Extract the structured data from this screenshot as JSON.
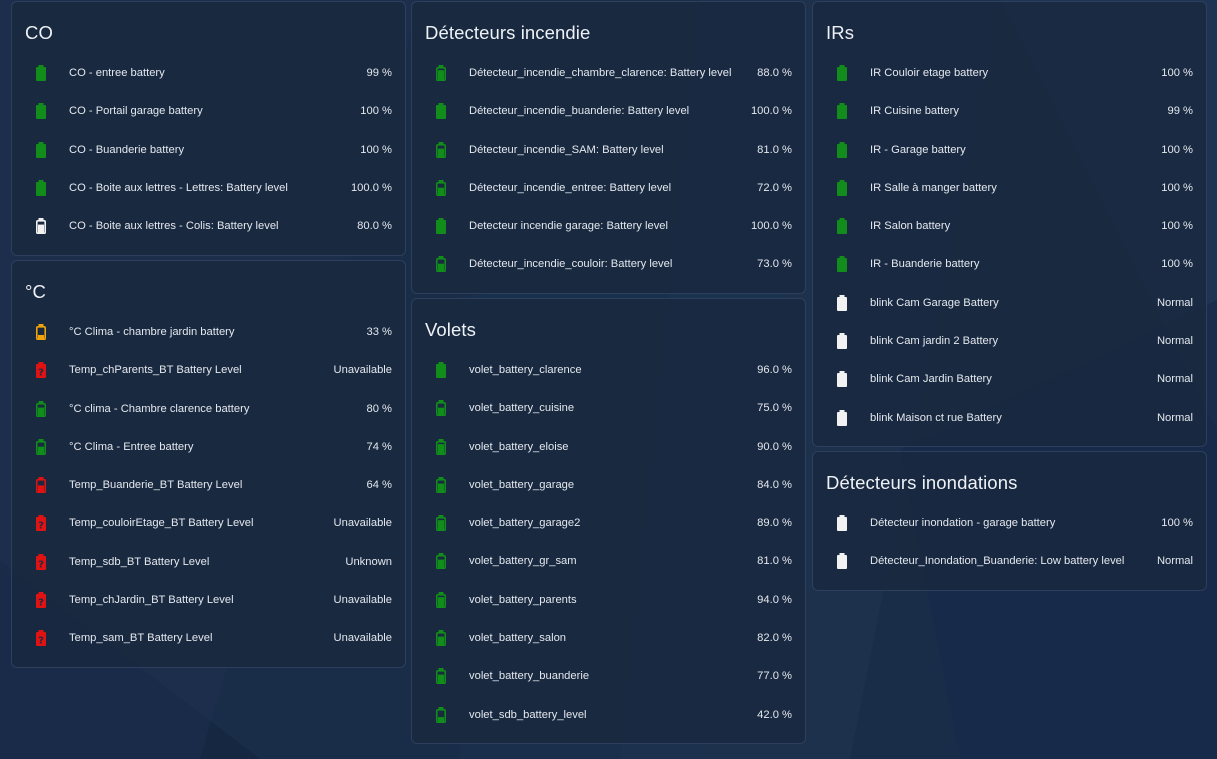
{
  "colors": {
    "green": "#128c1a",
    "white": "#f2f2f2",
    "orange": "#f0a30a",
    "red": "#e01212"
  },
  "cards": [
    {
      "title": "CO",
      "rows": [
        {
          "name": "CO - entree battery",
          "state": "99 %",
          "icon": "battery-full-icon",
          "color": "green"
        },
        {
          "name": "CO - Portail garage battery",
          "state": "100 %",
          "icon": "battery-full-icon",
          "color": "green"
        },
        {
          "name": "CO - Buanderie battery",
          "state": "100 %",
          "icon": "battery-full-icon",
          "color": "green"
        },
        {
          "name": "CO - Boite aux lettres - Lettres: Battery level",
          "state": "100.0 %",
          "icon": "battery-full-icon",
          "color": "green"
        },
        {
          "name": "CO - Boite aux lettres - Colis: Battery level",
          "state": "80.0 %",
          "icon": "battery-80-icon",
          "color": "white"
        }
      ]
    },
    {
      "title": "°C",
      "rows": [
        {
          "name": "°C Clima - chambre jardin battery",
          "state": "33 %",
          "icon": "battery-30-icon",
          "color": "orange"
        },
        {
          "name": "Temp_chParents_BT Battery Level",
          "state": "Unavailable",
          "icon": "battery-unknown-icon",
          "color": "red"
        },
        {
          "name": "°C clima - Chambre clarence battery",
          "state": "80 %",
          "icon": "battery-80-icon",
          "color": "green"
        },
        {
          "name": "°C Clima - Entree battery",
          "state": "74 %",
          "icon": "battery-70-icon",
          "color": "green"
        },
        {
          "name": "Temp_Buanderie_BT Battery Level",
          "state": "64 %",
          "icon": "battery-60-icon",
          "color": "red"
        },
        {
          "name": "Temp_couloirEtage_BT Battery Level",
          "state": "Unavailable",
          "icon": "battery-unknown-icon",
          "color": "red"
        },
        {
          "name": "Temp_sdb_BT Battery Level",
          "state": "Unknown",
          "icon": "battery-unknown-icon",
          "color": "red"
        },
        {
          "name": "Temp_chJardin_BT Battery Level",
          "state": "Unavailable",
          "icon": "battery-unknown-icon",
          "color": "red"
        },
        {
          "name": "Temp_sam_BT Battery Level",
          "state": "Unavailable",
          "icon": "battery-unknown-icon",
          "color": "red"
        }
      ]
    },
    {
      "title": "Détecteurs incendie",
      "rows": [
        {
          "name": "Détecteur_incendie_chambre_clarence: Battery level",
          "state": "88.0 %",
          "icon": "battery-90-icon",
          "color": "green"
        },
        {
          "name": "Détecteur_incendie_buanderie: Battery level",
          "state": "100.0 %",
          "icon": "battery-full-icon",
          "color": "green"
        },
        {
          "name": "Détecteur_incendie_SAM: Battery level",
          "state": "81.0 %",
          "icon": "battery-80-icon",
          "color": "green"
        },
        {
          "name": "Détecteur_incendie_entree: Battery level",
          "state": "72.0 %",
          "icon": "battery-70-icon",
          "color": "green"
        },
        {
          "name": "Detecteur incendie garage: Battery level",
          "state": "100.0 %",
          "icon": "battery-full-icon",
          "color": "green"
        },
        {
          "name": "Détecteur_incendie_couloir: Battery level",
          "state": "73.0 %",
          "icon": "battery-70-icon",
          "color": "green"
        }
      ]
    },
    {
      "title": "Volets",
      "rows": [
        {
          "name": "volet_battery_clarence",
          "state": "96.0 %",
          "icon": "battery-full-icon",
          "color": "green"
        },
        {
          "name": "volet_battery_cuisine",
          "state": "75.0 %",
          "icon": "battery-70-icon",
          "color": "green"
        },
        {
          "name": "volet_battery_eloise",
          "state": "90.0 %",
          "icon": "battery-90-icon",
          "color": "green"
        },
        {
          "name": "volet_battery_garage",
          "state": "84.0 %",
          "icon": "battery-80-icon",
          "color": "green"
        },
        {
          "name": "volet_battery_garage2",
          "state": "89.0 %",
          "icon": "battery-90-icon",
          "color": "green"
        },
        {
          "name": "volet_battery_gr_sam",
          "state": "81.0 %",
          "icon": "battery-80-icon",
          "color": "green"
        },
        {
          "name": "volet_battery_parents",
          "state": "94.0 %",
          "icon": "battery-90-icon",
          "color": "green"
        },
        {
          "name": "volet_battery_salon",
          "state": "82.0 %",
          "icon": "battery-80-icon",
          "color": "green"
        },
        {
          "name": "volet_battery_buanderie",
          "state": "77.0 %",
          "icon": "battery-80-icon",
          "color": "green"
        },
        {
          "name": "volet_sdb_battery_level",
          "state": "42.0 %",
          "icon": "battery-40-icon",
          "color": "green"
        }
      ]
    },
    {
      "title": "IRs",
      "rows": [
        {
          "name": "IR Couloir etage battery",
          "state": "100 %",
          "icon": "battery-full-icon",
          "color": "green"
        },
        {
          "name": "IR Cuisine battery",
          "state": "99 %",
          "icon": "battery-full-icon",
          "color": "green"
        },
        {
          "name": "IR - Garage battery",
          "state": "100 %",
          "icon": "battery-full-icon",
          "color": "green"
        },
        {
          "name": "IR Salle à manger battery",
          "state": "100 %",
          "icon": "battery-full-icon",
          "color": "green"
        },
        {
          "name": "IR Salon battery",
          "state": "100 %",
          "icon": "battery-full-icon",
          "color": "green"
        },
        {
          "name": "IR - Buanderie battery",
          "state": "100 %",
          "icon": "battery-full-icon",
          "color": "green"
        },
        {
          "name": "blink Cam Garage Battery",
          "state": "Normal",
          "icon": "battery-full-icon",
          "color": "white"
        },
        {
          "name": "blink Cam jardin 2 Battery",
          "state": "Normal",
          "icon": "battery-full-icon",
          "color": "white"
        },
        {
          "name": "blink Cam Jardin Battery",
          "state": "Normal",
          "icon": "battery-full-icon",
          "color": "white"
        },
        {
          "name": "blink Maison ct rue Battery",
          "state": "Normal",
          "icon": "battery-full-icon",
          "color": "white"
        }
      ]
    },
    {
      "title": "Détecteurs inondations",
      "rows": [
        {
          "name": "Détecteur inondation - garage battery",
          "state": "100 %",
          "icon": "battery-full-icon",
          "color": "white"
        },
        {
          "name": "Détecteur_Inondation_Buanderie: Low battery level",
          "state": "Normal",
          "icon": "battery-full-icon",
          "color": "white"
        }
      ]
    }
  ]
}
